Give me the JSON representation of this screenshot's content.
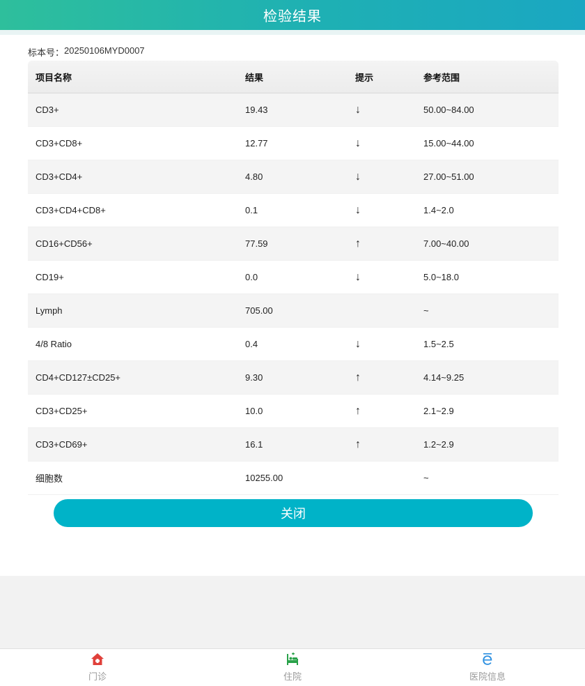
{
  "header": {
    "title": "检验结果"
  },
  "specimen": {
    "label": "标本号：",
    "value": "20250106MYD0007"
  },
  "table": {
    "columns": [
      "项目名称",
      "结果",
      "提示",
      "参考范围"
    ],
    "rows": [
      {
        "name": "CD3+",
        "result": "19.43",
        "flag": "↓",
        "range": "50.00~84.00"
      },
      {
        "name": "CD3+CD8+",
        "result": "12.77",
        "flag": "↓",
        "range": "15.00~44.00"
      },
      {
        "name": "CD3+CD4+",
        "result": "4.80",
        "flag": "↓",
        "range": "27.00~51.00"
      },
      {
        "name": "CD3+CD4+CD8+",
        "result": "0.1",
        "flag": "↓",
        "range": "1.4~2.0"
      },
      {
        "name": "CD16+CD56+",
        "result": "77.59",
        "flag": "↑",
        "range": "7.00~40.00"
      },
      {
        "name": "CD19+",
        "result": "0.0",
        "flag": "↓",
        "range": "5.0~18.0"
      },
      {
        "name": "Lymph",
        "result": "705.00",
        "flag": "",
        "range": "~"
      },
      {
        "name": "4/8 Ratio",
        "result": "0.4",
        "flag": "↓",
        "range": "1.5~2.5"
      },
      {
        "name": "CD4+CD127±CD25+",
        "result": "9.30",
        "flag": "↑",
        "range": "4.14~9.25"
      },
      {
        "name": "CD3+CD25+",
        "result": "10.0",
        "flag": "↑",
        "range": "2.1~2.9"
      },
      {
        "name": "CD3+CD69+",
        "result": "16.1",
        "flag": "↑",
        "range": "1.2~2.9"
      },
      {
        "name": "细胞数",
        "result": "10255.00",
        "flag": "",
        "range": "~"
      }
    ]
  },
  "close_button": {
    "label": "关闭"
  },
  "bottom_nav": {
    "items": [
      {
        "label": "门诊",
        "icon": "house-icon",
        "color": "#e0403a"
      },
      {
        "label": "住院",
        "icon": "hospital-bed-icon",
        "color": "#2aa24a"
      },
      {
        "label": "医院信息",
        "icon": "e-info-icon",
        "color": "#2a8ee0"
      }
    ]
  },
  "colors": {
    "accent": "#00b3c8",
    "header_start": "#2ebf9c",
    "header_end": "#1aa7c2"
  }
}
